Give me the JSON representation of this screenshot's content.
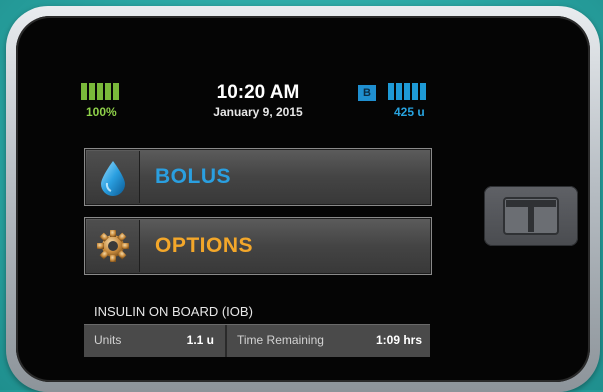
{
  "status": {
    "battery_percent": "100%",
    "time": "10:20 AM",
    "date": "January 9, 2015",
    "badge": "B",
    "insulin_units": "425 u",
    "battery_level": 1.0,
    "reservoir_level": 1.0
  },
  "menu": {
    "bolus_label": "BOLUS",
    "options_label": "OPTIONS"
  },
  "iob": {
    "title": "INSULIN ON BOARD (IOB)",
    "units_label": "Units",
    "units_value": "1.1 u",
    "time_label": "Time Remaining",
    "time_value": "1:09 hrs"
  },
  "icons": {
    "bolus": "water-drop-icon",
    "options": "gear-icon",
    "battery": "battery-icon",
    "reservoir": "insulin-reservoir-icon",
    "hardware": "t-logo-button"
  },
  "colors": {
    "background": "#2aa6a3",
    "bolus": "#2a9fe0",
    "options": "#f3a72a",
    "battery": "#7ab93a",
    "reservoir": "#1e9ad6"
  }
}
